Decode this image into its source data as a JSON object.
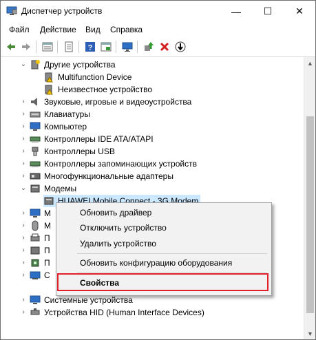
{
  "window": {
    "title": "Диспетчер устройств",
    "minimize": "—",
    "maximize": "☐",
    "close": "✕"
  },
  "menu": [
    "Файл",
    "Действие",
    "Вид",
    "Справка"
  ],
  "tree": {
    "other_devices": "Другие устройства",
    "multifunction": "Multifunction Device",
    "unknown": "Неизвестное устройство",
    "sound": "Звуковые, игровые и видеоустройства",
    "keyboards": "Клавиатуры",
    "computer": "Компьютер",
    "ide": "Контроллеры IDE ATA/ATAPI",
    "usb": "Контроллеры USB",
    "storage": "Контроллеры запоминающих устройств",
    "multifunction_adapters": "Многофункциональные адаптеры",
    "modems": "Модемы",
    "huawei": "HUAWEI Mobile Connect - 3G Modem",
    "partial": [
      "М",
      "М",
      "П",
      "П",
      "П",
      "С"
    ],
    "system": "Системные устройства",
    "hid": "Устройства HID (Human Interface Devices)"
  },
  "context_menu": {
    "update": "Обновить драйвер",
    "disable": "Отключить устройство",
    "uninstall": "Удалить устройство",
    "scan": "Обновить конфигурацию оборудования",
    "properties": "Свойства"
  },
  "colors": {
    "highlight_border": "#e0202a",
    "selection": "#cce8ff"
  }
}
